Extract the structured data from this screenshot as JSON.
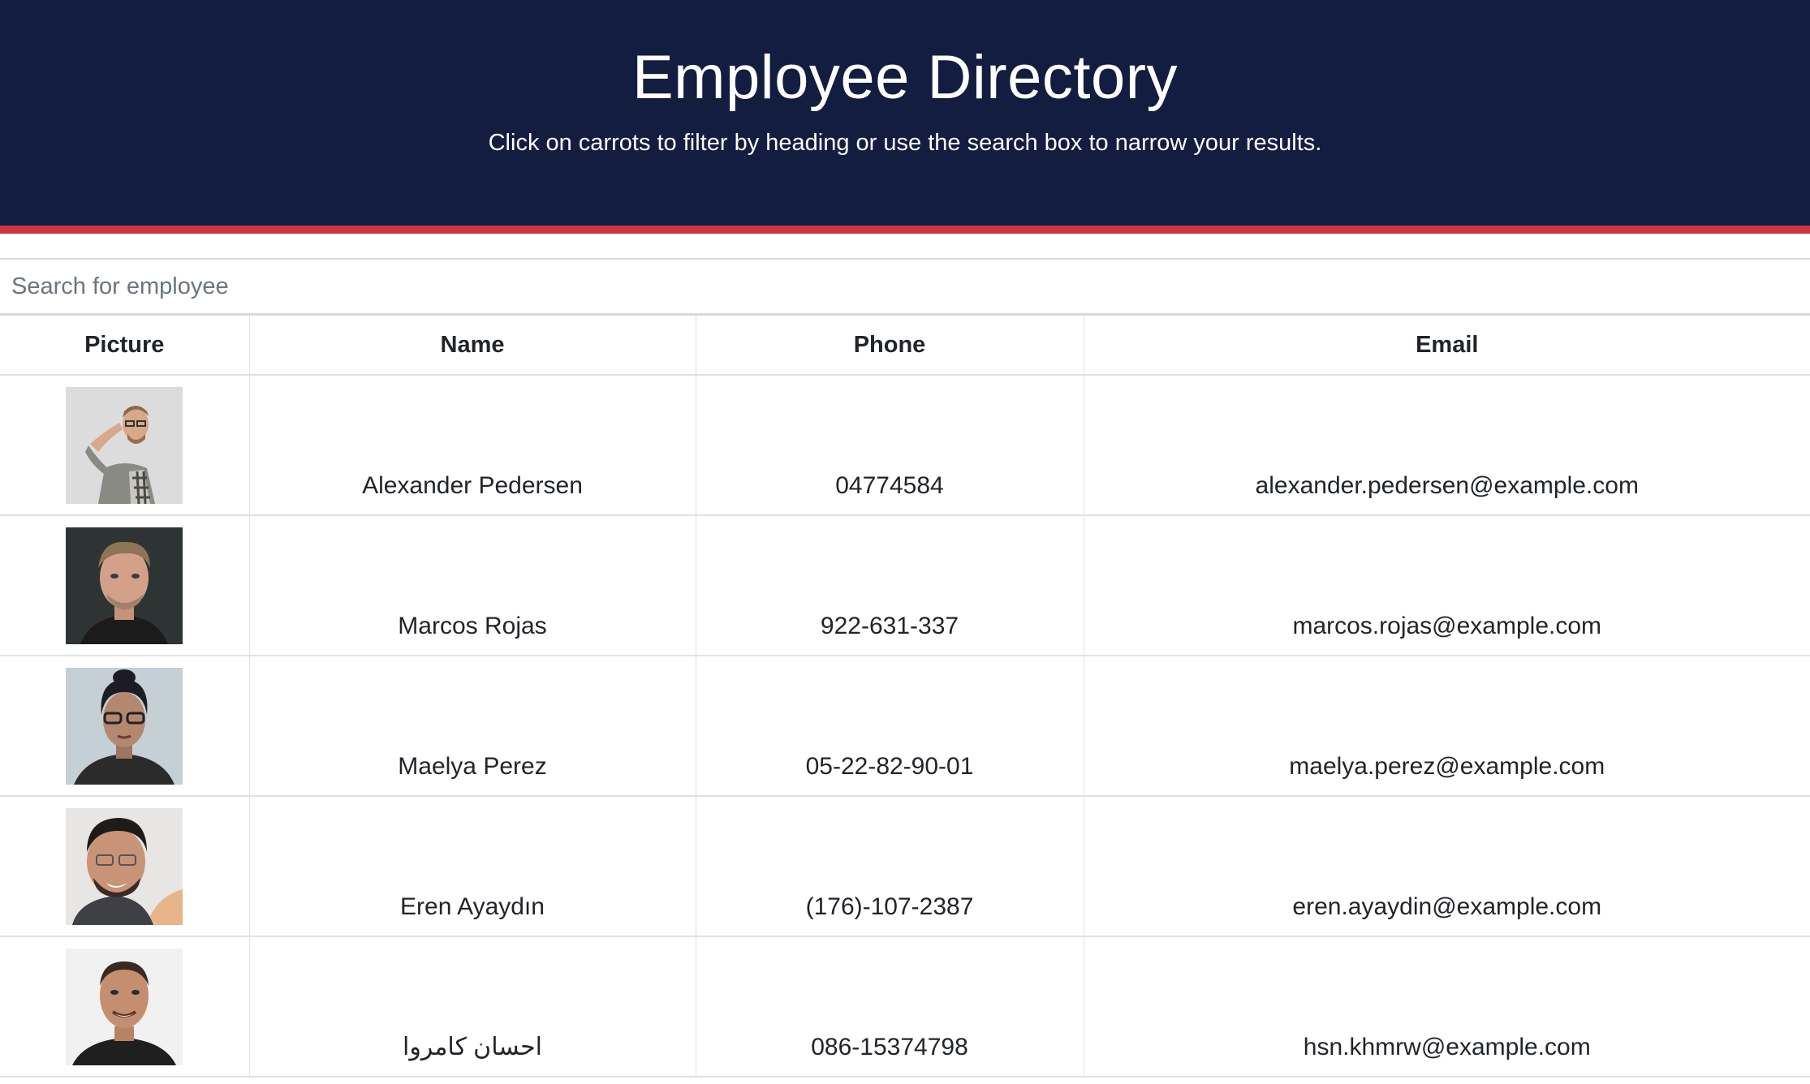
{
  "header": {
    "title": "Employee Directory",
    "subtitle": "Click on carrots to filter by heading or use the search box to narrow your results."
  },
  "search": {
    "placeholder": "Search for employee",
    "value": ""
  },
  "table": {
    "columns": [
      "Picture",
      "Name",
      "Phone",
      "Email"
    ],
    "rows": [
      {
        "name": "Alexander Pedersen",
        "phone": "04774584",
        "email": "alexander.pedersen@example.com",
        "picture": "man-with-glasses-photo"
      },
      {
        "name": "Marcos Rojas",
        "phone": "922-631-337",
        "email": "marcos.rojas@example.com",
        "picture": "man-portrait-photo"
      },
      {
        "name": "Maelya Perez",
        "phone": "05-22-82-90-01",
        "email": "maelya.perez@example.com",
        "picture": "woman-with-glasses-photo"
      },
      {
        "name": "Eren Ayaydın",
        "phone": "(176)-107-2387",
        "email": "eren.ayaydin@example.com",
        "picture": "smiling-man-photo"
      },
      {
        "name": "احسان کامروا",
        "phone": "086-15374798",
        "email": "hsn.khmrw@example.com",
        "picture": "bald-man-photo"
      }
    ]
  },
  "colors": {
    "header_bg": "#121d40",
    "accent_stripe": "#d0343e",
    "border": "#dee2e6"
  }
}
